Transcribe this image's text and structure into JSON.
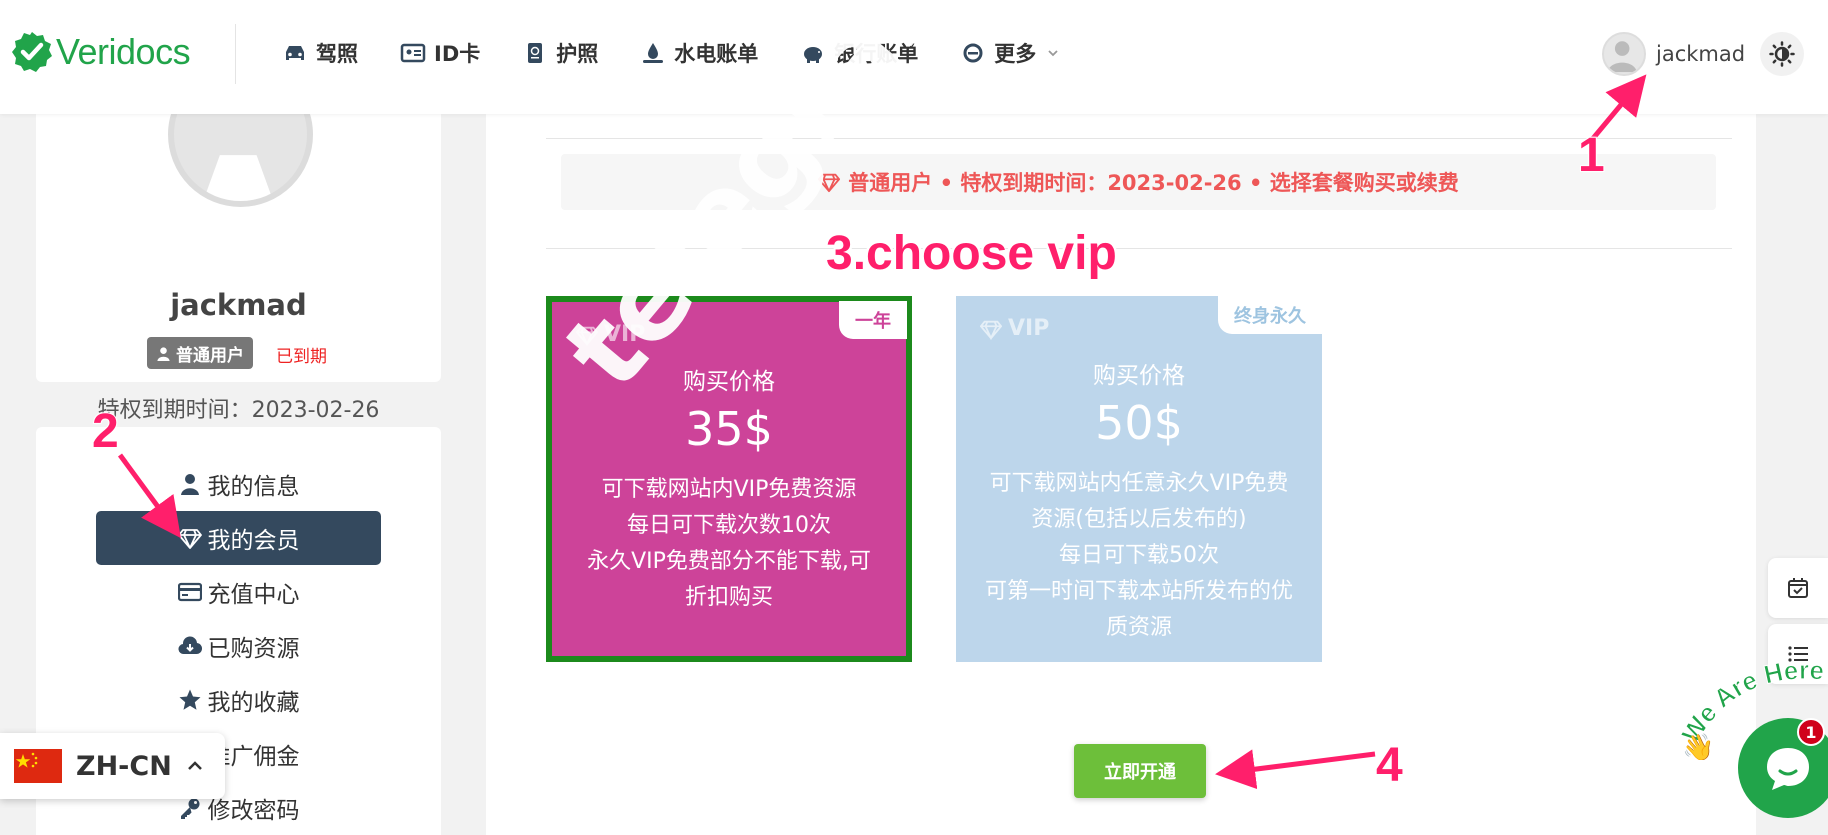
{
  "header": {
    "logo_text": "Veridocs",
    "nav": [
      {
        "label": "驾照",
        "icon": "car-icon"
      },
      {
        "label": "ID卡",
        "icon": "id-card-icon"
      },
      {
        "label": "护照",
        "icon": "passport-icon"
      },
      {
        "label": "水电账单",
        "icon": "utility-icon"
      },
      {
        "label": "银行账单",
        "icon": "piggy-bank-icon"
      },
      {
        "label": "更多",
        "icon": "ie-icon"
      }
    ],
    "username": "jackmad"
  },
  "profile": {
    "name": "jackmad",
    "role": "普通用户",
    "status": "已到期",
    "expire_label": "特权到期时间：",
    "expire_date": "2023-02-26"
  },
  "menu": {
    "items": [
      {
        "label": "我的信息",
        "icon": "user-icon",
        "active": false
      },
      {
        "label": "我的会员",
        "icon": "diamond-icon",
        "active": true
      },
      {
        "label": "充值中心",
        "icon": "credit-card-icon",
        "active": false
      },
      {
        "label": "已购资源",
        "icon": "cloud-download-icon",
        "active": false
      },
      {
        "label": "我的收藏",
        "icon": "star-icon",
        "active": false
      },
      {
        "label": "推广佣金",
        "icon": "money-icon",
        "active": false
      },
      {
        "label": "修改密码",
        "icon": "key-icon",
        "active": false
      }
    ]
  },
  "notice": {
    "text": "普通用户 • 特权到期时间：2023-02-26 • 选择套餐购买或续费"
  },
  "plans": [
    {
      "name": "VIP",
      "tag": "一年",
      "price_label": "购买价格",
      "price": "35$",
      "desc": [
        "可下载网站内VIP免费资源",
        "每日可下载次数10次",
        "永久VIP免费部分不能下载,可",
        "折扣购买"
      ]
    },
    {
      "name": "VIP",
      "tag": "终身永久",
      "price_label": "购买价格",
      "price": "50$",
      "desc": [
        "可下载网站内任意永久VIP免费",
        "资源(包括以后发布的)",
        "每日可下载50次",
        "可第一时间下载本站所发布的优",
        "质资源"
      ]
    }
  ],
  "open_button": "立即开通",
  "language": "ZH-CN",
  "chat": {
    "badge": "1",
    "greeting": "We Are Here!"
  },
  "annotations": {
    "n1": "1",
    "n2": "2",
    "step3": "3.choose vip",
    "n4": "4"
  },
  "watermark": "telegram.qtz"
}
